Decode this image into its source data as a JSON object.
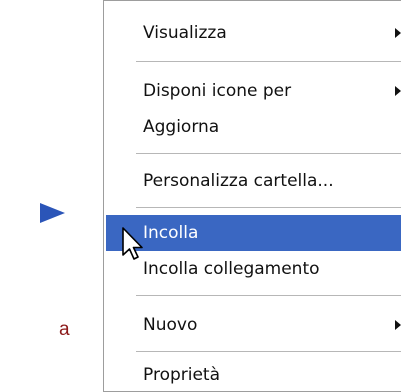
{
  "context_menu": {
    "items": [
      {
        "label": "Visualizza",
        "has_submenu": true
      },
      {
        "label": "Disponi icone per",
        "has_submenu": true
      },
      {
        "label": "Aggiorna",
        "has_submenu": false
      },
      {
        "label": "Personalizza cartella...",
        "has_submenu": false
      },
      {
        "label": "Incolla",
        "has_submenu": false,
        "highlighted": true
      },
      {
        "label": "Incolla collegamento",
        "has_submenu": false
      },
      {
        "label": "Nuovo",
        "has_submenu": true
      },
      {
        "label": "Proprietà",
        "has_submenu": false
      }
    ]
  },
  "margin_text": "a",
  "colors": {
    "highlight": "#3a67c2",
    "pointer_arrow": "#2b55b8",
    "margin_text": "#8c1a1a"
  },
  "icons": {
    "pointer": "right-triangle-pointer",
    "cursor": "mouse-arrow-cursor",
    "submenu": "submenu-arrow"
  }
}
